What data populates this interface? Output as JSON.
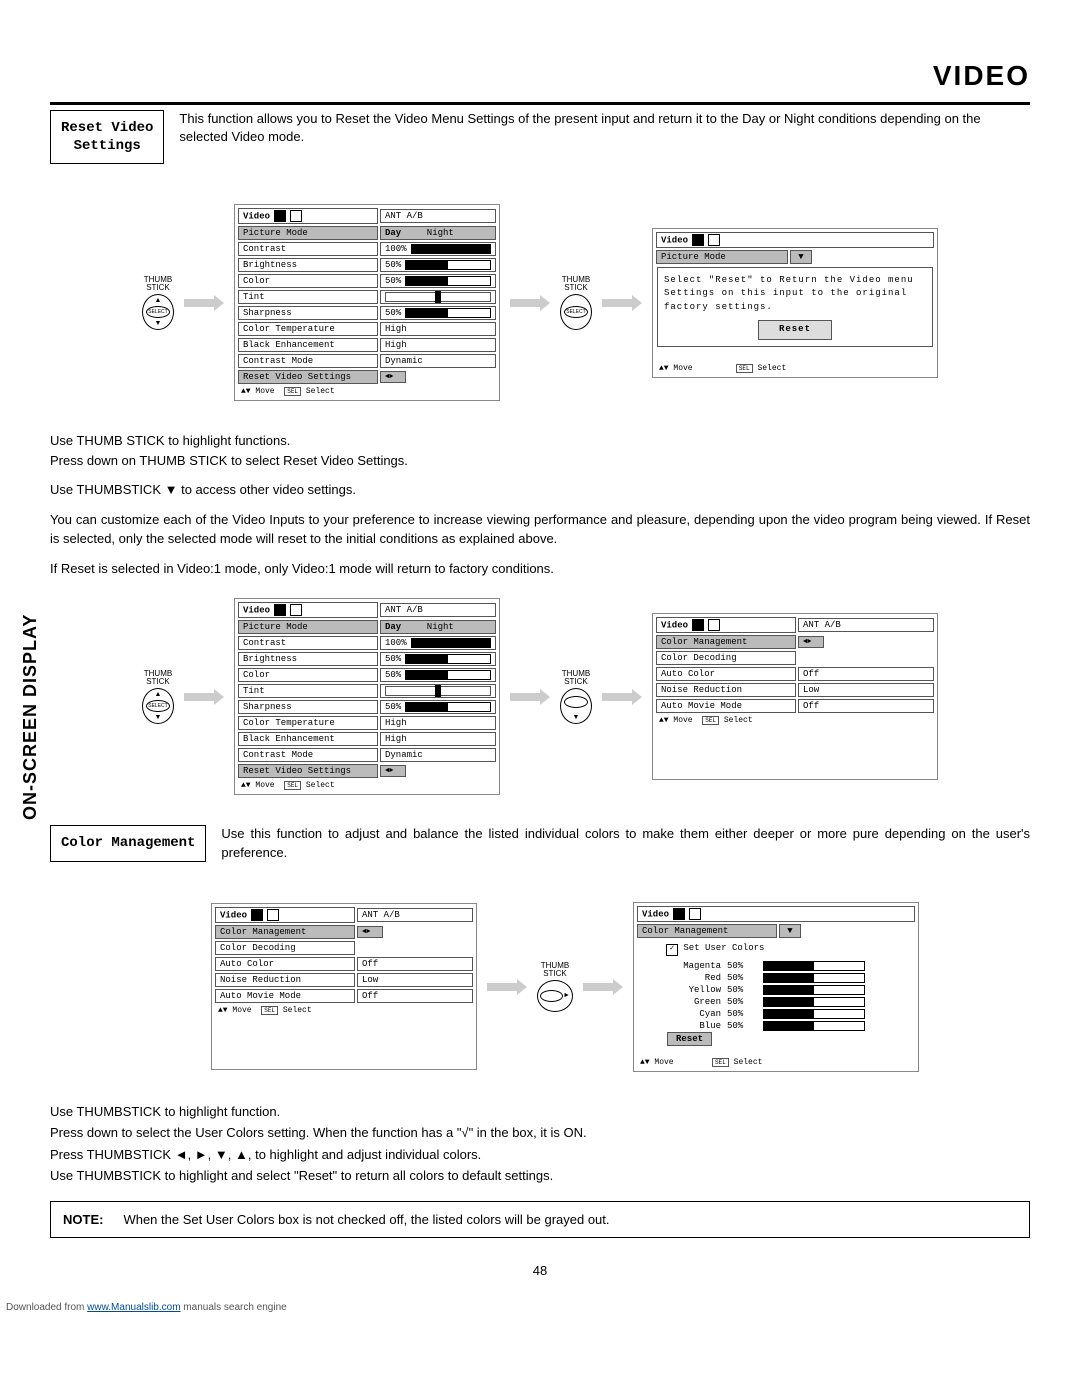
{
  "page_title": "VIDEO",
  "side_label": "ON-SCREEN DISPLAY",
  "page_number": "48",
  "download_prefix": "Downloaded from ",
  "download_link": "www.Manualslib.com",
  "download_suffix": " manuals search engine",
  "section1": {
    "label": "Reset Video\nSettings",
    "intro": "This function allows you to Reset the Video Menu Settings of the present input and return it to the Day or Night conditions depending on the selected Video mode.",
    "step1": "Use THUMB STICK to highlight functions.",
    "step2": "Press down on THUMB STICK to select Reset Video Settings.",
    "step3": "Use THUMBSTICK ▼ to access other video settings.",
    "para1": "You can customize each of the Video Inputs to your preference to increase viewing performance and pleasure, depending upon the video program being viewed. If Reset is selected, only the selected mode will reset to the initial conditions as explained above.",
    "para2": "If Reset is selected in Video:1 mode, only Video:1 mode will return to factory conditions."
  },
  "section2": {
    "label": "Color Management",
    "intro": "Use this function to adjust and balance the listed individual colors to make them either deeper or more pure depending on the user's preference.",
    "step1": "Use THUMBSTICK to highlight function.",
    "step2": "Press down to select the User Colors setting.  When the function has a \"√\" in the box, it is ON.",
    "step3": "Press THUMBSTICK ◄, ►, ▼, ▲, to highlight and adjust individual colors.",
    "step4": "Use THUMBSTICK to highlight and select \"Reset\" to return all colors to default settings."
  },
  "note": {
    "label": "NOTE:",
    "text": "When the Set User Colors box is not checked off, the listed colors will be grayed out."
  },
  "osd_labels": {
    "thumb": "THUMB\nSTICK",
    "select_btn": "SELECT",
    "move": "Move",
    "select": "Select",
    "sel_icon": "SEL"
  },
  "osd1": {
    "title": "Video",
    "ant": "ANT A/B",
    "rows": [
      {
        "l": "Picture Mode",
        "r": "Day",
        "r2": "Night",
        "hl": true
      },
      {
        "l": "Contrast",
        "v": "100%",
        "bar": "100"
      },
      {
        "l": "Brightness",
        "v": "50%",
        "bar": "50"
      },
      {
        "l": "Color",
        "v": "50%",
        "bar": "50"
      },
      {
        "l": "Tint",
        "tint": true
      },
      {
        "l": "Sharpness",
        "v": "50%",
        "bar": "50"
      },
      {
        "l": "Color Temperature",
        "r": "High"
      },
      {
        "l": "Black Enhancement",
        "r": "High"
      },
      {
        "l": "Contrast Mode",
        "r": "Dynamic"
      },
      {
        "l": "Reset Video Settings",
        "hl": true,
        "arrows": true
      }
    ]
  },
  "osd2": {
    "title": "Video",
    "rows": [
      {
        "l": "Picture Mode",
        "hl": true,
        "arrow_down": true
      }
    ],
    "msg": "Select \"Reset\" to Return the Video menu Settings on this input to the original factory settings.",
    "btn": "Reset"
  },
  "osd3": {
    "title": "Video",
    "ant": "ANT A/B",
    "rows": [
      {
        "l": "Color Management",
        "hl": true,
        "arrows": true
      },
      {
        "l": "Color Decoding"
      },
      {
        "l": "Auto Color",
        "r": "Off"
      },
      {
        "l": "Noise Reduction",
        "r": "Low"
      },
      {
        "l": "Auto Movie Mode",
        "r": "Off"
      }
    ]
  },
  "osd4": {
    "title": "Video",
    "rows": [
      {
        "l": "Color Management",
        "hl": true,
        "arrow_down": true
      }
    ],
    "set_user": "Set User Colors",
    "colors": [
      {
        "n": "Magenta",
        "p": "50%"
      },
      {
        "n": "Red",
        "p": "50%"
      },
      {
        "n": "Yellow",
        "p": "50%"
      },
      {
        "n": "Green",
        "p": "50%"
      },
      {
        "n": "Cyan",
        "p": "50%"
      },
      {
        "n": "Blue",
        "p": "50%"
      }
    ],
    "reset": "Reset"
  }
}
